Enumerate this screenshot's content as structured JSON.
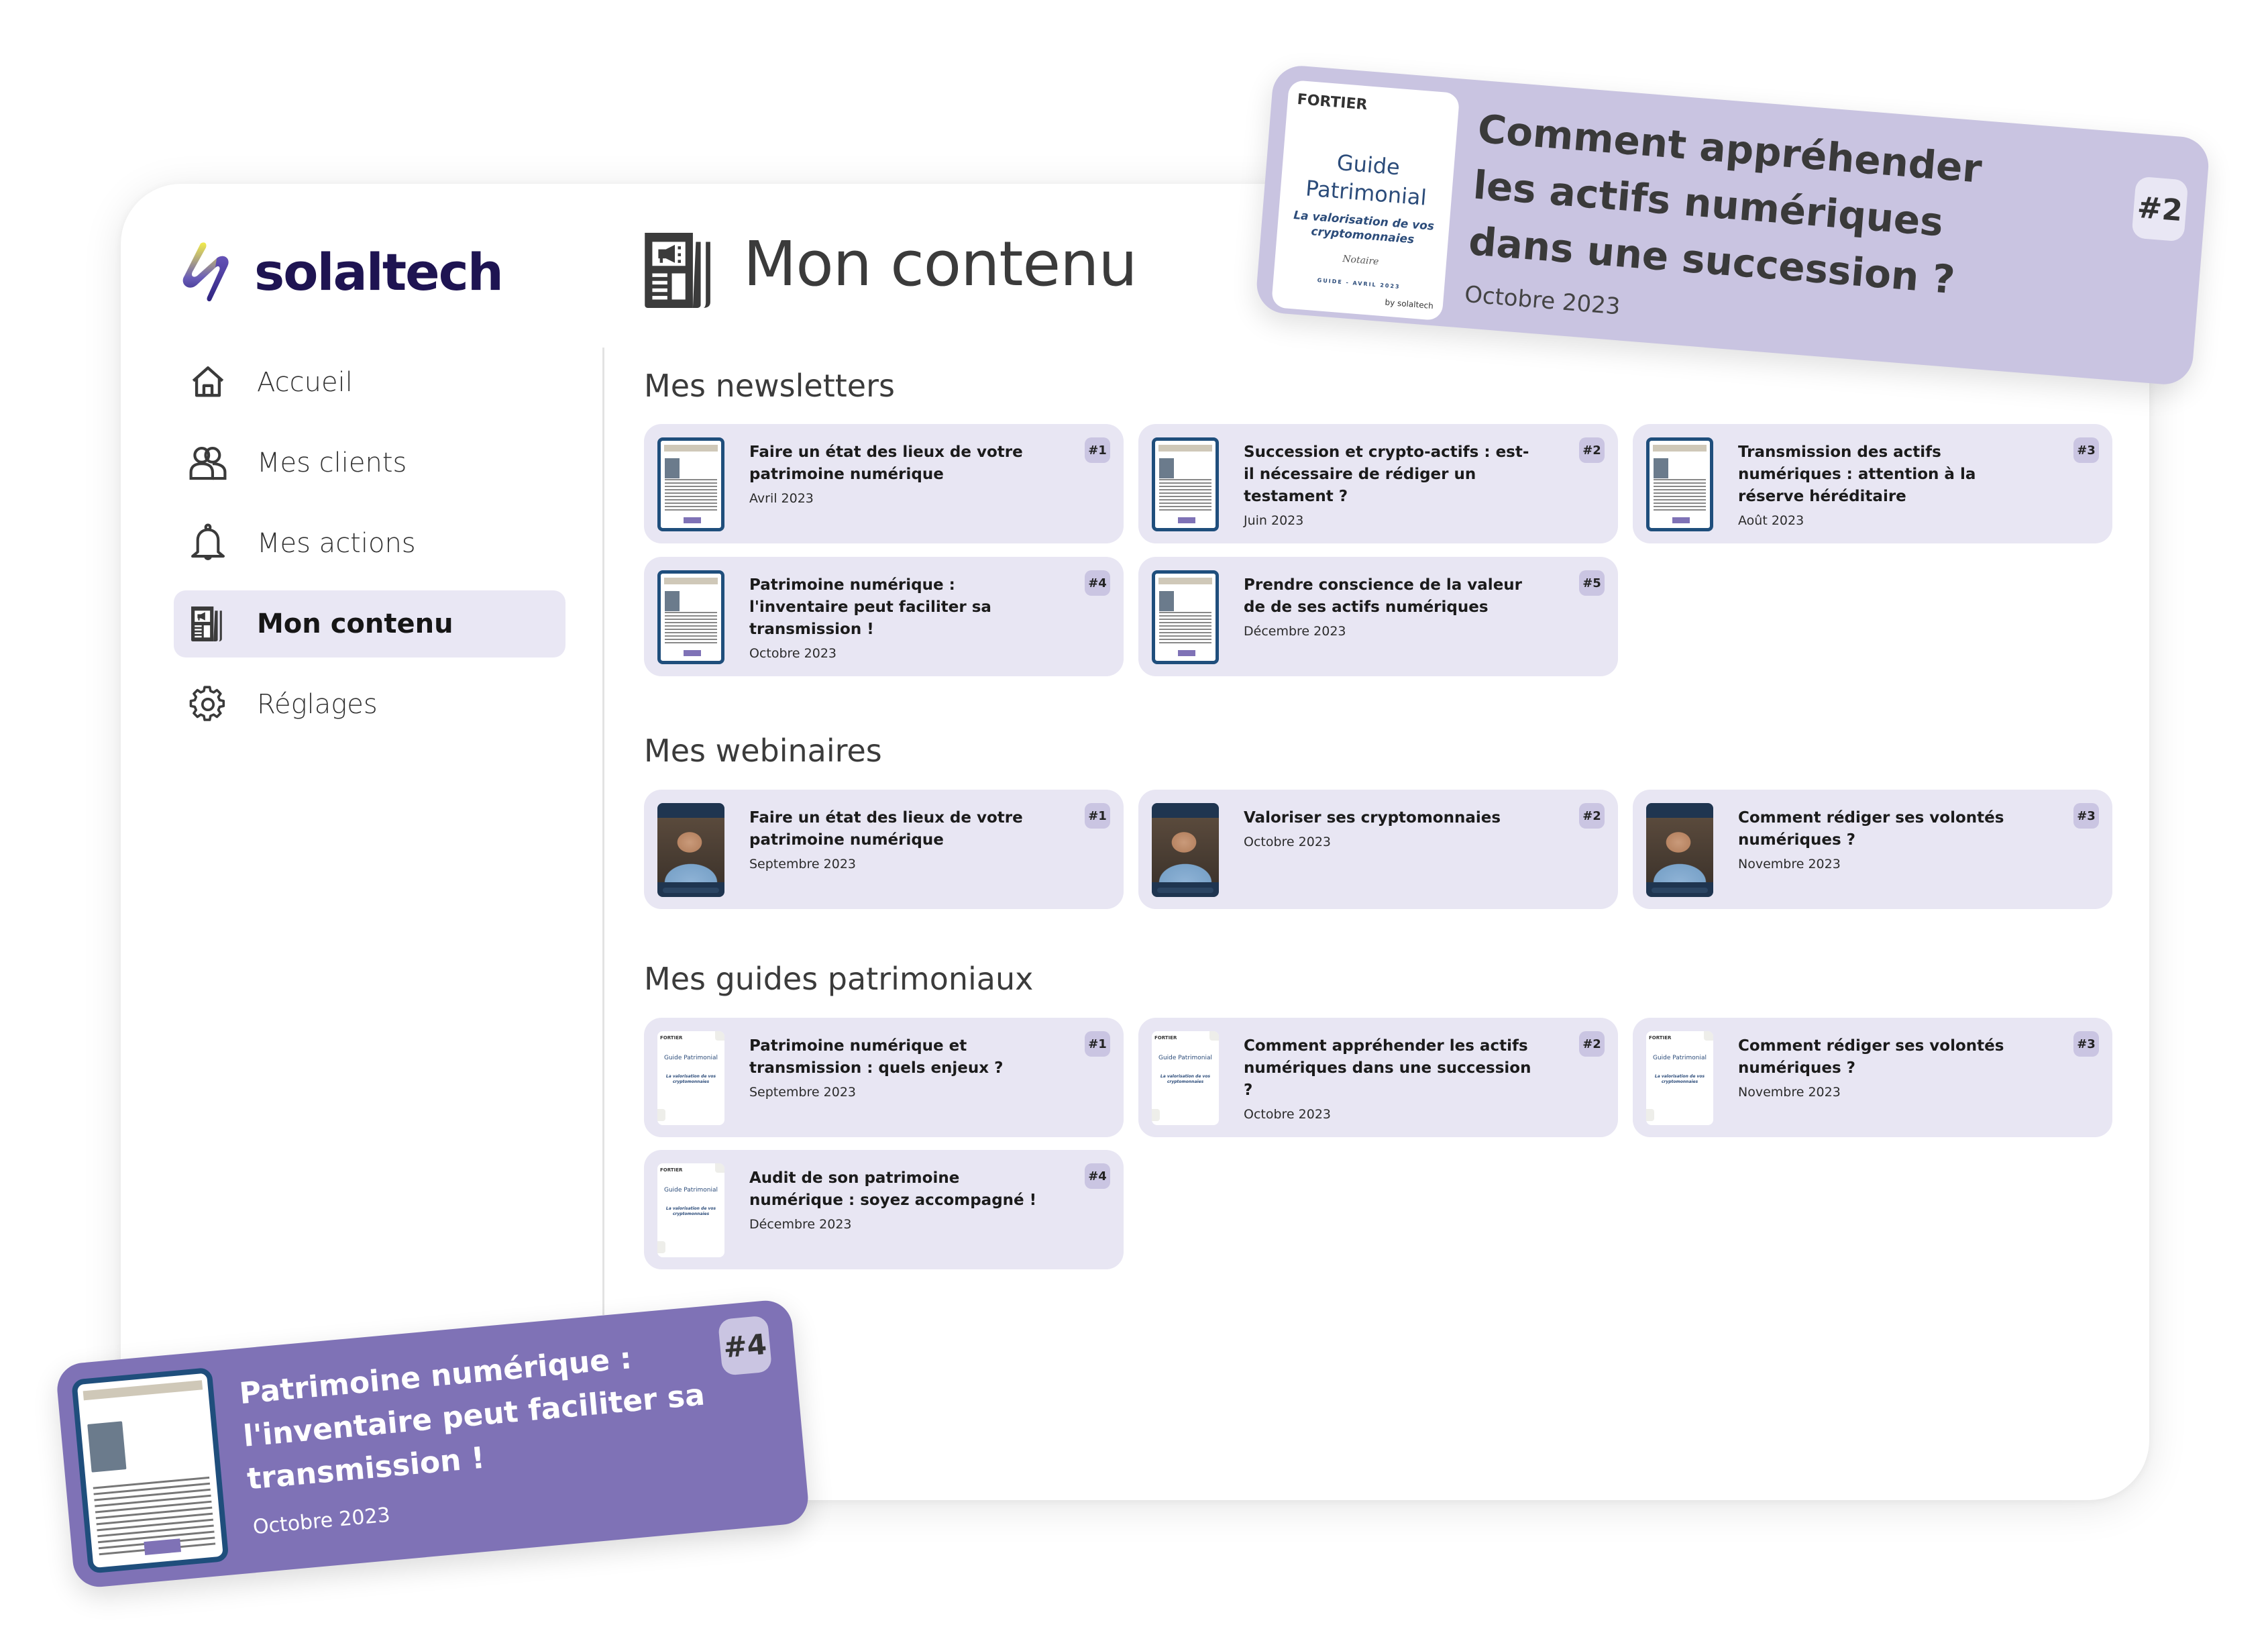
{
  "brand": {
    "name": "solaltech",
    "color": "#1E1452"
  },
  "sidebar": {
    "items": [
      {
        "label": "Accueil",
        "icon": "home-icon",
        "active": false
      },
      {
        "label": "Mes clients",
        "icon": "users-icon",
        "active": false
      },
      {
        "label": "Mes actions",
        "icon": "bell-icon",
        "active": false
      },
      {
        "label": "Mon contenu",
        "icon": "newspaper-icon",
        "active": true
      },
      {
        "label": "Réglages",
        "icon": "gear-icon",
        "active": false
      }
    ]
  },
  "header": {
    "title": "Mon contenu",
    "icon": "newspaper-icon"
  },
  "sections": {
    "newsletters": {
      "title": "Mes newsletters",
      "items": [
        {
          "badge": "#1",
          "title": "Faire un état des lieux de votre patrimoine numérique",
          "date": "Avril 2023"
        },
        {
          "badge": "#2",
          "title": "Succession et crypto-actifs : est-il nécessaire de rédiger un testament ?",
          "date": "Juin 2023"
        },
        {
          "badge": "#3",
          "title": "Transmission des actifs numériques : attention à la réserve héréditaire",
          "date": "Août 2023"
        },
        {
          "badge": "#4",
          "title": "Patrimoine numérique : l'inventaire peut faciliter sa transmission !",
          "date": "Octobre 2023"
        },
        {
          "badge": "#5",
          "title": "Prendre conscience de la valeur de de ses actifs numériques",
          "date": "Décembre 2023"
        }
      ]
    },
    "webinaires": {
      "title": "Mes webinaires",
      "items": [
        {
          "badge": "#1",
          "title": "Faire un état des lieux de votre patrimoine numérique",
          "date": "Septembre 2023"
        },
        {
          "badge": "#2",
          "title": "Valoriser ses cryptomonnaies",
          "date": "Octobre 2023"
        },
        {
          "badge": "#3",
          "title": "Comment rédiger ses volontés numériques ?",
          "date": "Novembre 2023"
        }
      ]
    },
    "guides": {
      "title": "Mes guides patrimoniaux",
      "items": [
        {
          "badge": "#1",
          "title": "Patrimoine numérique et transmission : quels enjeux ?",
          "date": "Septembre 2023"
        },
        {
          "badge": "#2",
          "title": "Comment appréhender les actifs numériques dans une succession ?",
          "date": "Octobre 2023"
        },
        {
          "badge": "#3",
          "title": "Comment rédiger ses volontés numériques ?",
          "date": "Novembre 2023"
        },
        {
          "badge": "#4",
          "title": "Audit de son patrimoine numérique : soyez accompagné !",
          "date": "Décembre 2023"
        }
      ]
    }
  },
  "guide_cover": {
    "brand": "FORTIER",
    "title": "Guide Patrimonial",
    "subtitle": "La valorisation de vos cryptomonnaies",
    "notaire": "Notaire",
    "footer": "GUIDE - AVRIL 2023",
    "by": "by solaltech"
  },
  "featured": {
    "guide": {
      "badge": "#2",
      "title": "Comment appréhender les actifs numériques dans une succession ?",
      "date": "Octobre 2023"
    },
    "newsletter": {
      "badge": "#4",
      "title": "Patrimoine numérique : l'inventaire peut faciliter sa transmission !",
      "date": "Octobre 2023"
    }
  },
  "colors": {
    "card_bg": "#E8E6F3",
    "badge_bg": "#CAC5E2",
    "active_nav_bg": "#E9E7F4",
    "featured_light": "#C9C4E1",
    "featured_dark": "#7F72B6"
  }
}
